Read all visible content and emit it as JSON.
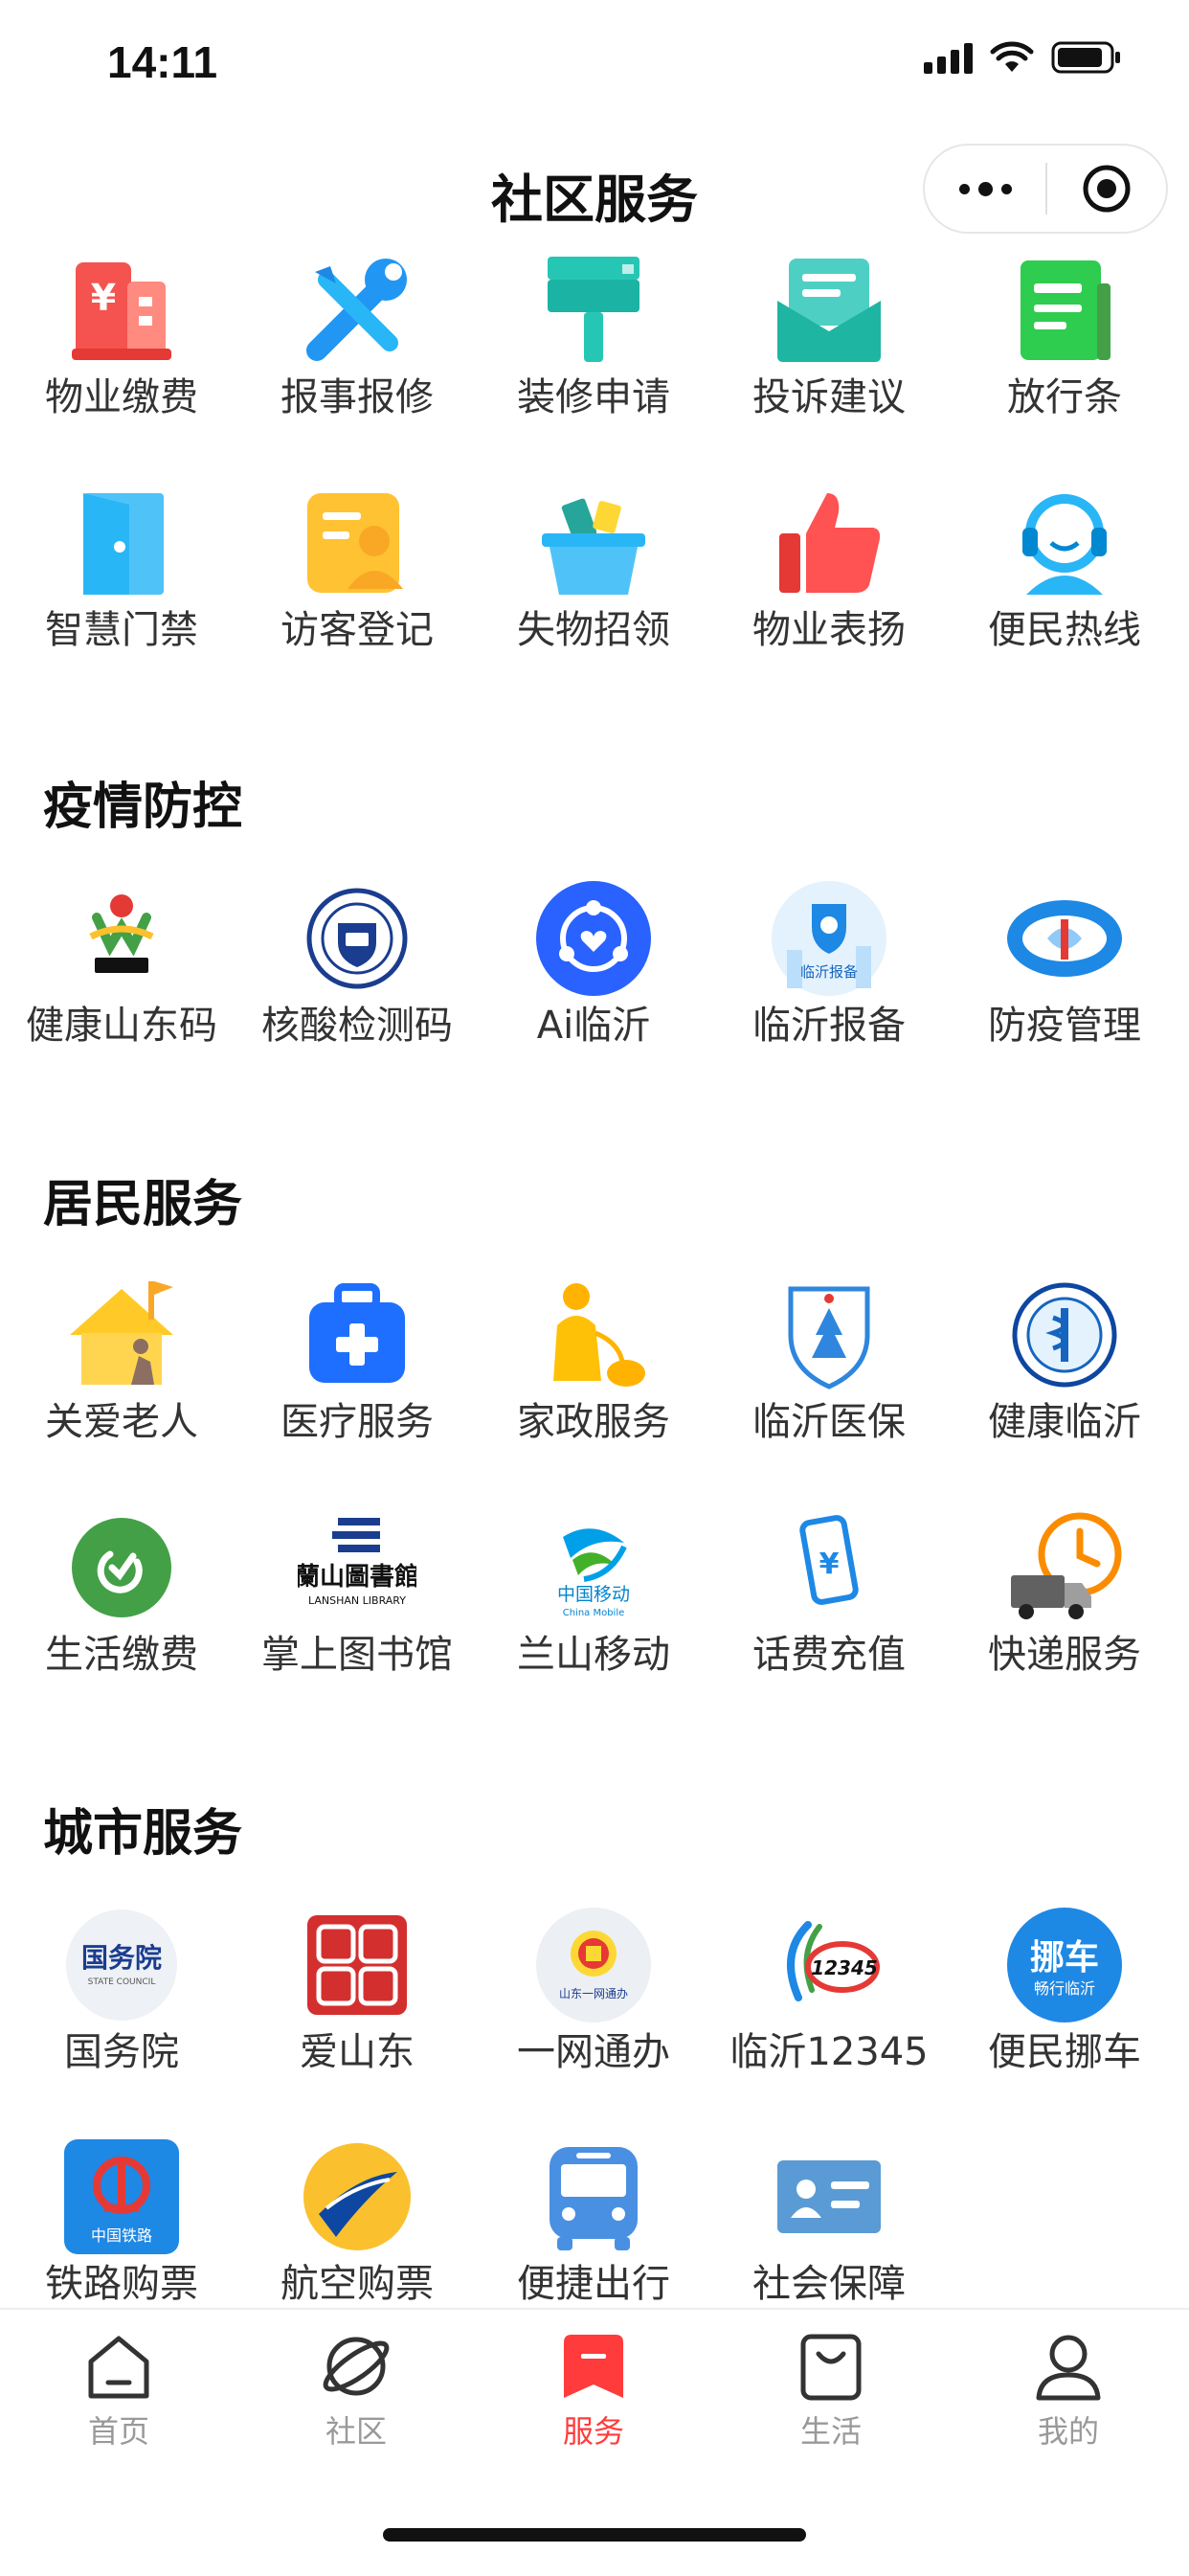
{
  "status_bar": {
    "time": "14:11"
  },
  "header": {
    "title": "社区服务"
  },
  "top_rows": [
    [
      {
        "label": "物业缴费",
        "icon": "property-fee-icon"
      },
      {
        "label": "报事报修",
        "icon": "repair-tools-icon"
      },
      {
        "label": "装修申请",
        "icon": "paint-roller-icon"
      },
      {
        "label": "投诉建议",
        "icon": "mail-envelope-icon"
      },
      {
        "label": "放行条",
        "icon": "pass-note-icon"
      }
    ],
    [
      {
        "label": "智慧门禁",
        "icon": "door-icon"
      },
      {
        "label": "访客登记",
        "icon": "visitor-card-icon"
      },
      {
        "label": "失物招领",
        "icon": "lost-found-basket-icon"
      },
      {
        "label": "物业表扬",
        "icon": "thumbs-up-icon"
      },
      {
        "label": "便民热线",
        "icon": "headset-icon"
      }
    ]
  ],
  "sections": [
    {
      "title": "疫情防控",
      "rows": [
        [
          {
            "label": "健康山东码",
            "icon": "healthy-shandong-logo-icon"
          },
          {
            "label": "核酸检测码",
            "icon": "nucleic-test-badge-icon"
          },
          {
            "label": "Ai临沂",
            "icon": "ai-linyi-logo-icon"
          },
          {
            "label": "临沂报备",
            "icon": "linyi-report-logo-icon",
            "text": "临沂报备"
          },
          {
            "label": "防疫管理",
            "icon": "epidemic-management-logo-icon"
          }
        ]
      ]
    },
    {
      "title": "居民服务",
      "rows": [
        [
          {
            "label": "关爱老人",
            "icon": "elderly-care-house-icon"
          },
          {
            "label": "医疗服务",
            "icon": "medical-kit-icon"
          },
          {
            "label": "家政服务",
            "icon": "housekeeping-icon"
          },
          {
            "label": "临沂医保",
            "icon": "medical-insurance-shield-icon"
          },
          {
            "label": "健康临沂",
            "icon": "health-linyi-emblem-icon"
          }
        ],
        [
          {
            "label": "生活缴费",
            "icon": "life-payment-check-icon"
          },
          {
            "label": "掌上图书馆",
            "icon": "lanshan-library-logo-icon",
            "text": "蘭山圖書館",
            "subtext": "LANSHAN LIBRARY"
          },
          {
            "label": "兰山移动",
            "icon": "china-mobile-logo-icon",
            "text": "中国移动",
            "subtext": "China Mobile"
          },
          {
            "label": "话费充值",
            "icon": "phone-recharge-icon"
          },
          {
            "label": "快递服务",
            "icon": "delivery-truck-clock-icon"
          }
        ]
      ]
    },
    {
      "title": "城市服务",
      "rows": [
        [
          {
            "label": "国务院",
            "icon": "state-council-logo-icon",
            "text": "国务院",
            "subtext": "STATE COUNCIL"
          },
          {
            "label": "爱山东",
            "icon": "ai-shandong-seal-icon"
          },
          {
            "label": "一网通办",
            "icon": "one-network-emblem-icon",
            "text": "山东一网通办"
          },
          {
            "label": "临沂12345",
            "icon": "hotline-12345-logo-icon",
            "text": "12345"
          },
          {
            "label": "便民挪车",
            "icon": "move-car-logo-icon",
            "text": "挪车",
            "subtext": "畅行临沂"
          }
        ],
        [
          {
            "label": "铁路购票",
            "icon": "railway-logo-icon",
            "text": "中国铁路"
          },
          {
            "label": "航空购票",
            "icon": "airline-logo-icon"
          },
          {
            "label": "便捷出行",
            "icon": "bus-icon"
          },
          {
            "label": "社会保障",
            "icon": "social-security-card-icon"
          }
        ]
      ]
    }
  ],
  "tabs": [
    {
      "label": "首页",
      "icon": "home-icon"
    },
    {
      "label": "社区",
      "icon": "planet-icon"
    },
    {
      "label": "服务",
      "icon": "service-bookmark-icon",
      "active": true
    },
    {
      "label": "生活",
      "icon": "shopping-bag-icon"
    },
    {
      "label": "我的",
      "icon": "profile-icon"
    }
  ],
  "colors": {
    "accent": "#ff3b3b",
    "tab_inactive": "#999999"
  }
}
